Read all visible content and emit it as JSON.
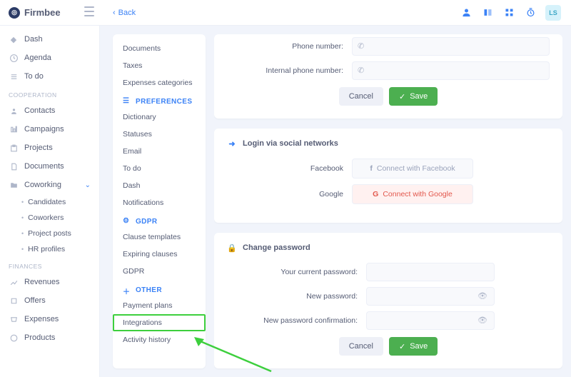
{
  "brand": "Firmbee",
  "back_label": "Back",
  "avatar_initials": "LS",
  "sidebar": {
    "items": [
      {
        "label": "Dash"
      },
      {
        "label": "Agenda"
      },
      {
        "label": "To do"
      }
    ],
    "section_cooperation": "COOPERATION",
    "coop_items": [
      {
        "label": "Contacts"
      },
      {
        "label": "Campaigns"
      },
      {
        "label": "Projects"
      },
      {
        "label": "Documents"
      },
      {
        "label": "Coworking"
      }
    ],
    "coworking_children": [
      {
        "label": "Candidates"
      },
      {
        "label": "Coworkers"
      },
      {
        "label": "Project posts"
      },
      {
        "label": "HR profiles"
      }
    ],
    "section_finances": "FINANCES",
    "fin_items": [
      {
        "label": "Revenues"
      },
      {
        "label": "Offers"
      },
      {
        "label": "Expenses"
      },
      {
        "label": "Products"
      }
    ]
  },
  "subnav": {
    "group_top": [
      {
        "label": "Documents"
      },
      {
        "label": "Taxes"
      },
      {
        "label": "Expenses categories"
      }
    ],
    "head_preferences": "PREFERENCES",
    "group_pref": [
      {
        "label": "Dictionary"
      },
      {
        "label": "Statuses"
      },
      {
        "label": "Email"
      },
      {
        "label": "To do"
      },
      {
        "label": "Dash"
      },
      {
        "label": "Notifications"
      }
    ],
    "head_gdpr": "GDPR",
    "group_gdpr": [
      {
        "label": "Clause templates"
      },
      {
        "label": "Expiring clauses"
      },
      {
        "label": "GDPR"
      }
    ],
    "head_other": "OTHER",
    "group_other": [
      {
        "label": "Payment plans"
      },
      {
        "label": "Integrations"
      },
      {
        "label": "Activity history"
      }
    ]
  },
  "contact": {
    "phone_label": "Phone number:",
    "internal_label": "Internal phone number:",
    "cancel": "Cancel",
    "save": "Save"
  },
  "social": {
    "title": "Login via social networks",
    "facebook_label": "Facebook",
    "google_label": "Google",
    "connect_fb": "Connect with Facebook",
    "connect_gg": "Connect with Google"
  },
  "password": {
    "title": "Change password",
    "current_label": "Your current password:",
    "new_label": "New password:",
    "confirm_label": "New password confirmation:",
    "cancel": "Cancel",
    "save": "Save"
  }
}
